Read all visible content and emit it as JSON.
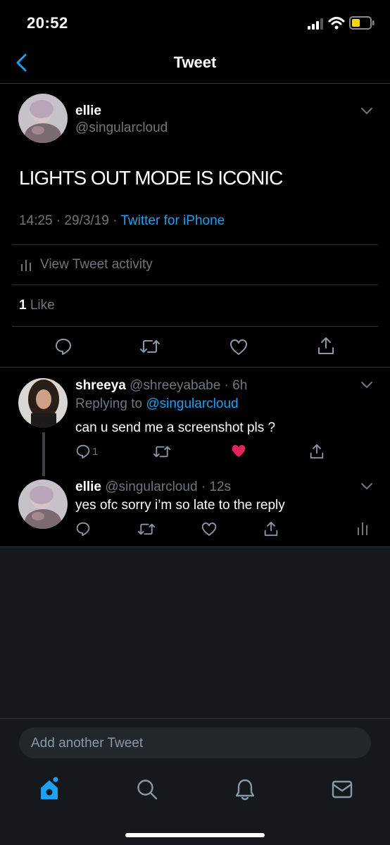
{
  "status_bar": {
    "time": "20:52"
  },
  "navbar": {
    "title": "Tweet"
  },
  "main_tweet": {
    "name": "ellie",
    "handle": "@singularcloud",
    "text": "LIGHTS OUT MODE IS ICONIC",
    "timestamp": "14:25 · 29/3/19 · ",
    "source": "Twitter for iPhone",
    "activity_label": "View Tweet activity",
    "like_count": "1",
    "like_label": "Like"
  },
  "replies": [
    {
      "name": "shreeya",
      "handle_time": "@shreeyababe · 6h",
      "replying_prefix": "Replying to ",
      "replying_to": "@singularcloud",
      "text": "can u send me a screenshot pls ?",
      "reply_count": "1",
      "liked": true
    },
    {
      "name": "ellie",
      "handle_time": "@singularcloud · 12s",
      "text": "yes ofc sorry i’m so late to the reply",
      "liked": false
    }
  ],
  "compose": {
    "placeholder": "Add another Tweet"
  },
  "tabbar": {
    "items": [
      "home-icon",
      "search-icon",
      "bell-icon",
      "mail-icon"
    ]
  },
  "colors": {
    "accent": "#1da1f2",
    "like": "#e0245e",
    "background": "#000000",
    "panel": "#15181c"
  }
}
